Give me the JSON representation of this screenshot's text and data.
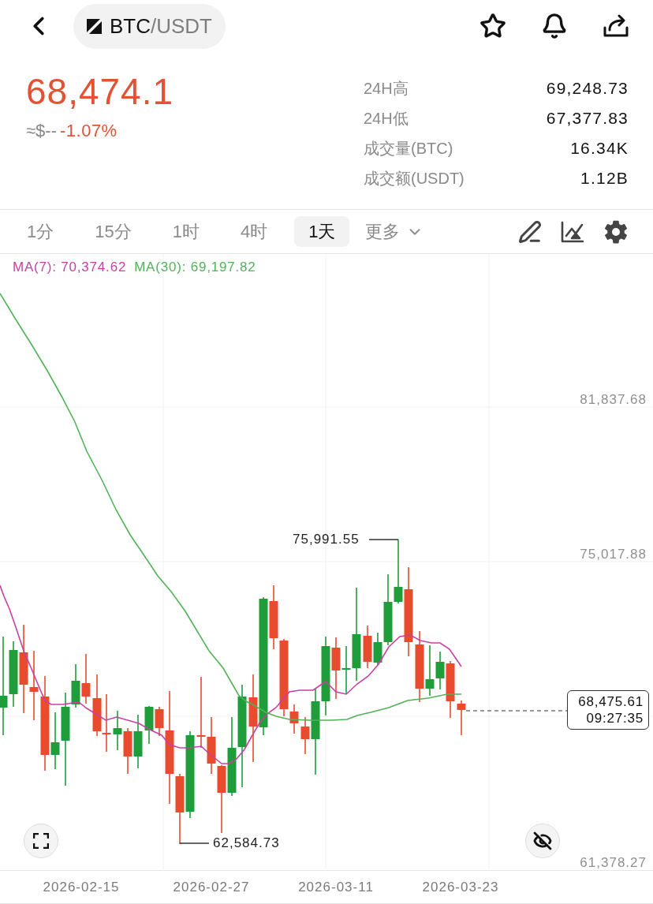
{
  "header": {
    "pair": {
      "base": "BTC",
      "quote": "/USDT"
    }
  },
  "ticker": {
    "last_price": "68,474.1",
    "fiat_value": "≈$--",
    "change": "-1.07%"
  },
  "stats": [
    {
      "label": "24H高",
      "value": "69,248.73"
    },
    {
      "label": "24H低",
      "value": "67,377.83"
    },
    {
      "label": "成交量(BTC)",
      "value": "16.34K"
    },
    {
      "label": "成交额(USDT)",
      "value": "1.12B"
    }
  ],
  "intervals": [
    {
      "label": "1分",
      "selected": false
    },
    {
      "label": "15分",
      "selected": false
    },
    {
      "label": "1时",
      "selected": false
    },
    {
      "label": "4时",
      "selected": false
    },
    {
      "label": "1天",
      "selected": true
    }
  ],
  "more_button": {
    "label": "更多"
  },
  "chart": {
    "indicators": [
      {
        "label": "MA(7): 70,374.62",
        "color": "#c93fa2"
      },
      {
        "label": "MA(30): 69,197.82",
        "color": "#52b25a"
      }
    ],
    "price_axis": [
      "81,837.68",
      "75,017.88",
      "61,378.27"
    ],
    "high_marker": "75,991.55",
    "low_marker": "62,584.73",
    "price_tag": {
      "price": "68,475.61",
      "countdown": "09:27:35"
    },
    "date_axis": [
      "2026-02-15",
      "2026-02-27",
      "2026-03-11",
      "2026-03-23"
    ]
  }
}
